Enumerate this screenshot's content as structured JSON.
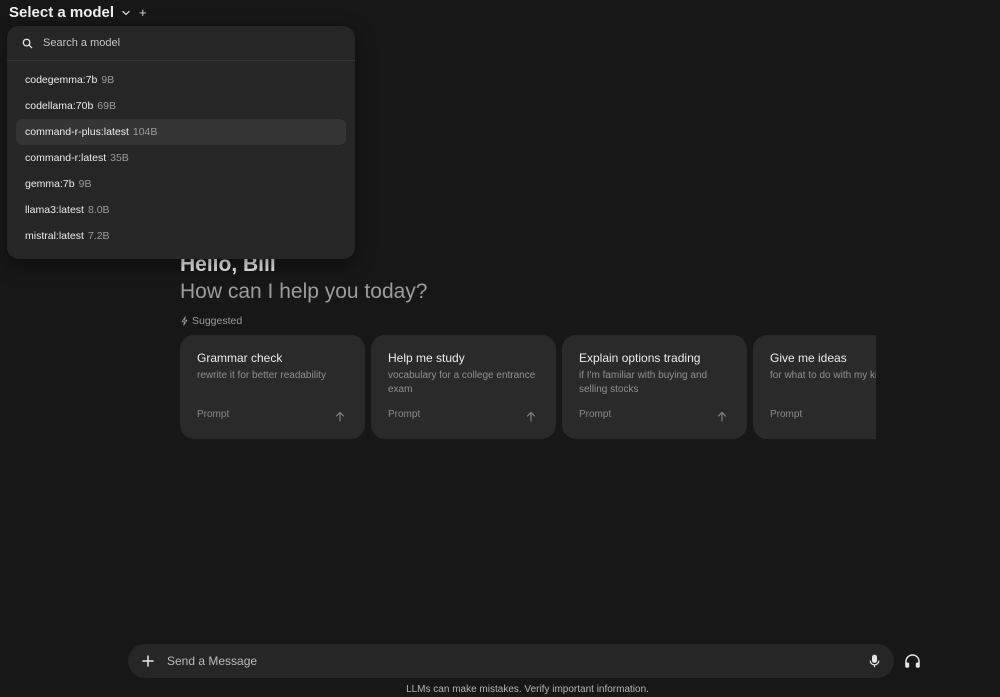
{
  "header": {
    "title": "Select a model",
    "add_symbol": "+"
  },
  "dropdown": {
    "search_placeholder": "Search a model",
    "models": [
      {
        "name": "codegemma:7b",
        "size": "9B"
      },
      {
        "name": "codellama:70b",
        "size": "69B"
      },
      {
        "name": "command-r-plus:latest",
        "size": "104B"
      },
      {
        "name": "command-r:latest",
        "size": "35B"
      },
      {
        "name": "gemma:7b",
        "size": "9B"
      },
      {
        "name": "llama3:latest",
        "size": "8.0B"
      },
      {
        "name": "mistral:latest",
        "size": "7.2B"
      }
    ]
  },
  "greeting": {
    "hello": "Hello, Bill",
    "subtitle": "How can I help you today?"
  },
  "suggested": {
    "label": "Suggested",
    "cards": [
      {
        "title": "Grammar check",
        "description": "rewrite it for better readability",
        "prompt_label": "Prompt"
      },
      {
        "title": "Help me study",
        "description": "vocabulary for a college entrance exam",
        "prompt_label": "Prompt"
      },
      {
        "title": "Explain options trading",
        "description": "if I'm familiar with buying and selling stocks",
        "prompt_label": "Prompt"
      },
      {
        "title": "Give me ideas",
        "description": "for what to do with my kids' art",
        "prompt_label": "Prompt"
      }
    ]
  },
  "composer": {
    "placeholder": "Send a Message"
  },
  "footer": {
    "note": "LLMs can make mistakes. Verify important information."
  },
  "colors": {
    "background": "#171717",
    "panel": "#262626",
    "card": "#2a2a2a",
    "highlight": "#353535"
  }
}
